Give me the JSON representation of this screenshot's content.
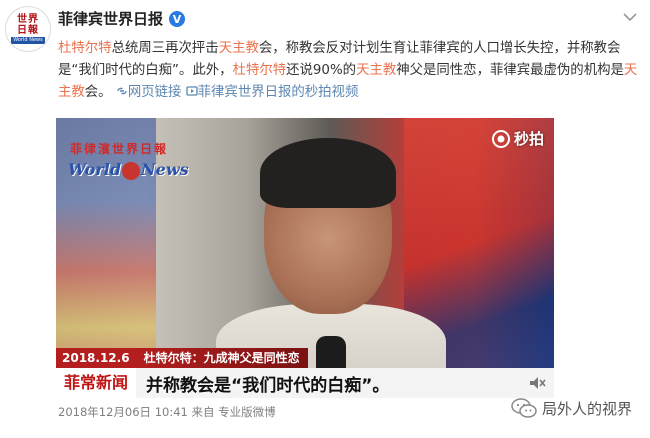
{
  "account": {
    "avatar_line1": "世界",
    "avatar_line2": "日報",
    "avatar_line3": "World News",
    "name": "菲律宾世界日报"
  },
  "post": {
    "t1": "杜特尔特",
    "t2": "总统周三再次抨击",
    "t3": "天主教",
    "t4": "会，称教会反对计划生育让菲律宾的人口增长失控，并称教会是“我们时代的白痴”。此外，",
    "t5": "杜特尔特",
    "t6": "还说90%的",
    "t7": "天主教",
    "t8": "神父是同性恋，菲律宾最虚伪的机构是",
    "t9": "天主教",
    "t10": "会。",
    "link1": "网页链接",
    "link2": "菲律宾世界日报的秒拍视频"
  },
  "video": {
    "watermark_cn": "菲律濱世界日報",
    "watermark_en_1": "World",
    "watermark_en_2": "News",
    "platform": "秒拍",
    "date_tag": "2018.12.6",
    "caption_top": "杜特尔特：九成神父是同性恋",
    "brand": "菲常新闻",
    "caption_main": "并称教会是“我们时代的白痴”。"
  },
  "footer": {
    "meta": "2018年12月06日 10:41 来自 专业版微博"
  },
  "overlay_brand": "局外人的视界",
  "colors": {
    "highlight": "#eb7350",
    "link": "#5d87b1",
    "brand_red": "#b51e1e"
  }
}
